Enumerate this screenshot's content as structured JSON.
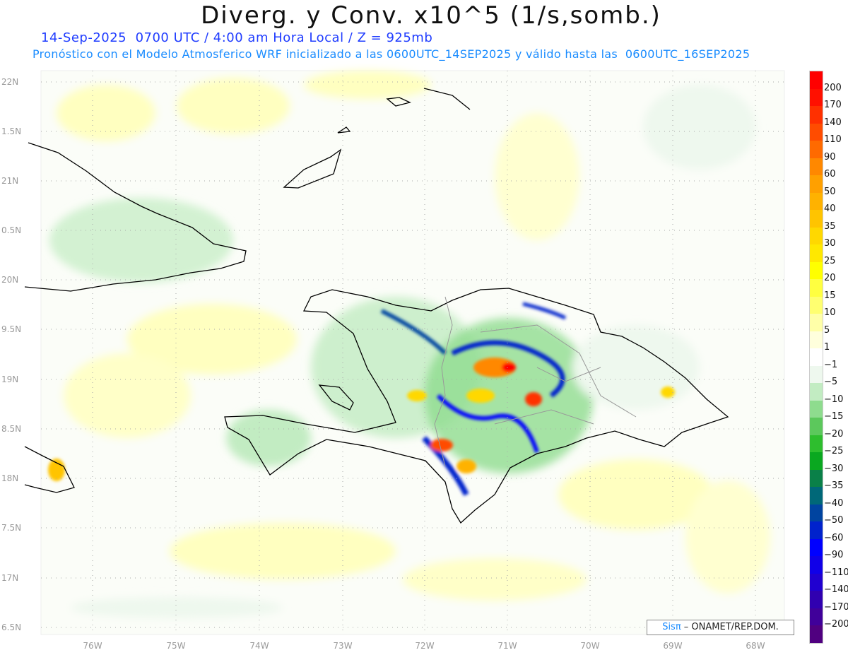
{
  "header": {
    "title": "Diverg. y Conv. x10^5 (1/s,somb.)",
    "subtitle": "14-Sep-2025  0700 UTC / 4:00 am Hora Local / Z = 925mb",
    "forecast_info": "Pronóstico con el Modelo Atmosferico WRF inicializado a las 0600UTC_14SEP2025 y válido hasta las  0600UTC_16SEP2025"
  },
  "axes": {
    "lat_labels": [
      "22N",
      "1.5N",
      "21N",
      "0.5N",
      "20N",
      "9.5N",
      "19N",
      "8.5N",
      "18N",
      "7.5N",
      "17N",
      "6.5N"
    ],
    "lon_labels": [
      "76W",
      "75W",
      "74W",
      "73W",
      "72W",
      "71W",
      "70W",
      "69W",
      "68W"
    ]
  },
  "colorbar": {
    "labels": [
      "200",
      "170",
      "140",
      "110",
      "90",
      "60",
      "50",
      "40",
      "35",
      "30",
      "25",
      "20",
      "15",
      "10",
      "5",
      "1",
      "−1",
      "−5",
      "−10",
      "−15",
      "−20",
      "−25",
      "−30",
      "−35",
      "−40",
      "−50",
      "−60",
      "−90",
      "−110",
      "−140",
      "−170",
      "−200"
    ],
    "colors": [
      "#ff0000",
      "#ff1000",
      "#ff3000",
      "#ff4c00",
      "#ff6a00",
      "#ff8800",
      "#ffa000",
      "#ffb200",
      "#ffc400",
      "#ffd800",
      "#ffe800",
      "#ffff00",
      "#ffff40",
      "#ffff70",
      "#ffffa8",
      "#ffffdc",
      "#ffffff",
      "#eef8ee",
      "#c2ecc2",
      "#8edc8e",
      "#5cc85c",
      "#2ebe2e",
      "#0aa820",
      "#0a8048",
      "#006878",
      "#0044a0",
      "#0022cc",
      "#0000ff",
      "#1000e8",
      "#2000d0",
      "#3000b0",
      "#40009a",
      "#500080"
    ]
  },
  "credit": {
    "brand": "Sisπ",
    "text": " –  ONAMET/REP.DOM."
  }
}
